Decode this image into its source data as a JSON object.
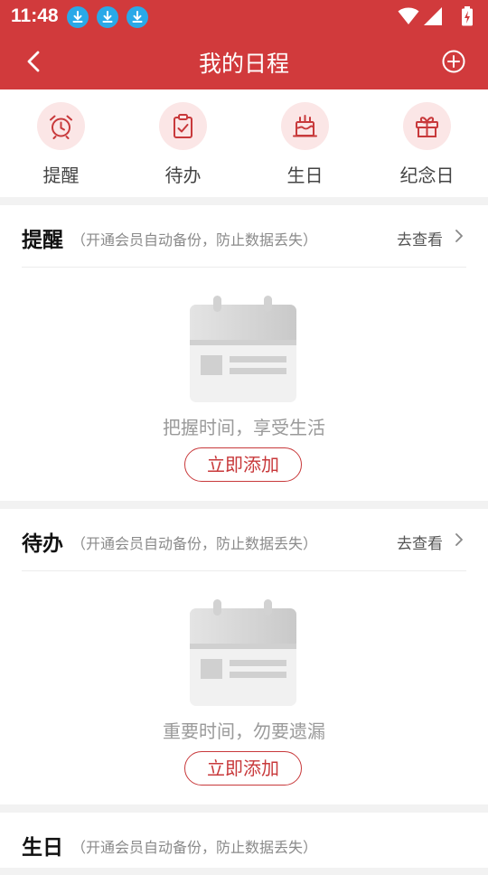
{
  "status_bar": {
    "time": "11:48",
    "icons": [
      "download-icon",
      "download-icon",
      "download-icon",
      "wifi-icon",
      "signal-icon",
      "battery-charging-icon"
    ]
  },
  "nav": {
    "title": "我的日程",
    "back_icon": "chevron-left-icon",
    "add_icon": "add-circle-icon"
  },
  "quick_nav": [
    {
      "label": "提醒",
      "icon": "alarm-clock-icon"
    },
    {
      "label": "待办",
      "icon": "clipboard-check-icon"
    },
    {
      "label": "生日",
      "icon": "cake-icon"
    },
    {
      "label": "纪念日",
      "icon": "gift-icon"
    }
  ],
  "sections": [
    {
      "title": "提醒",
      "subtitle": "（开通会员自动备份，防止数据丢失）",
      "more": "去查看",
      "empty_text": "把握时间，享受生活",
      "add_label": "立即添加"
    },
    {
      "title": "待办",
      "subtitle": "（开通会员自动备份，防止数据丢失）",
      "more": "去查看",
      "empty_text": "重要时间，勿要遗漏",
      "add_label": "立即添加"
    },
    {
      "title": "生日",
      "subtitle": "（开通会员自动备份，防止数据丢失）"
    }
  ],
  "colors": {
    "accent": "#d13a3c",
    "icon_bg": "#fbe6e6",
    "download_badge": "#2aa9e8"
  }
}
